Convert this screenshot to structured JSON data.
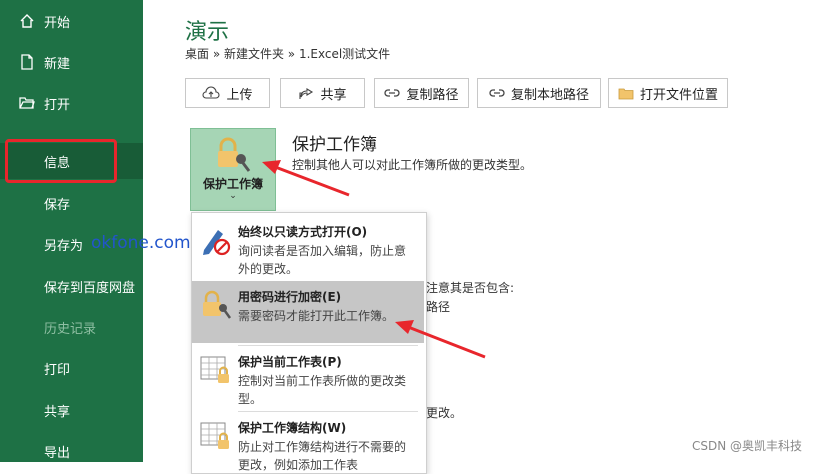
{
  "sidebar": {
    "items": [
      {
        "label": "开始",
        "icon": "home-icon"
      },
      {
        "label": "新建",
        "icon": "new-doc-icon"
      },
      {
        "label": "打开",
        "icon": "folder-open-icon"
      },
      {
        "label": "信息"
      },
      {
        "label": "保存"
      },
      {
        "label": "另存为"
      },
      {
        "label": "保存到百度网盘"
      },
      {
        "label": "历史记录"
      },
      {
        "label": "打印"
      },
      {
        "label": "共享"
      },
      {
        "label": "导出"
      }
    ]
  },
  "watermark": "okfone.com",
  "main": {
    "title": "演示",
    "breadcrumb": "桌面 » 新建文件夹 » 1.Excel测试文件",
    "toolbar": {
      "upload": "上传",
      "share": "共享",
      "copy_path": "复制路径",
      "copy_local_path": "复制本地路径",
      "open_location": "打开文件位置"
    },
    "protect": {
      "tile_label": "保护工作簿",
      "heading": "保护工作簿",
      "description": "控制其他人可以对此工作簿所做的更改类型。"
    },
    "background_fragments": {
      "line1": "注意其是否包含:",
      "line2": "路径",
      "line3": "更改。"
    }
  },
  "dropdown": {
    "items": [
      {
        "title": "始终以只读方式打开(O)",
        "desc": "询问读者是否加入编辑，防止意外的更改。",
        "icon": "pencil-no-icon"
      },
      {
        "title": "用密码进行加密(E)",
        "desc": "需要密码才能打开此工作簿。",
        "icon": "lock-key-icon"
      },
      {
        "title": "保护当前工作表(P)",
        "desc": "控制对当前工作表所做的更改类型。",
        "icon": "sheet-lock-icon"
      },
      {
        "title": "保护工作簿结构(W)",
        "desc": "防止对工作簿结构进行不需要的更改，例如添加工作表",
        "icon": "workbook-lock-icon"
      }
    ]
  },
  "credit": "CSDN @奥凯丰科技",
  "colors": {
    "sidebar": "#1e7145",
    "accent": "#1e7145",
    "annotation": "#e8262c"
  }
}
